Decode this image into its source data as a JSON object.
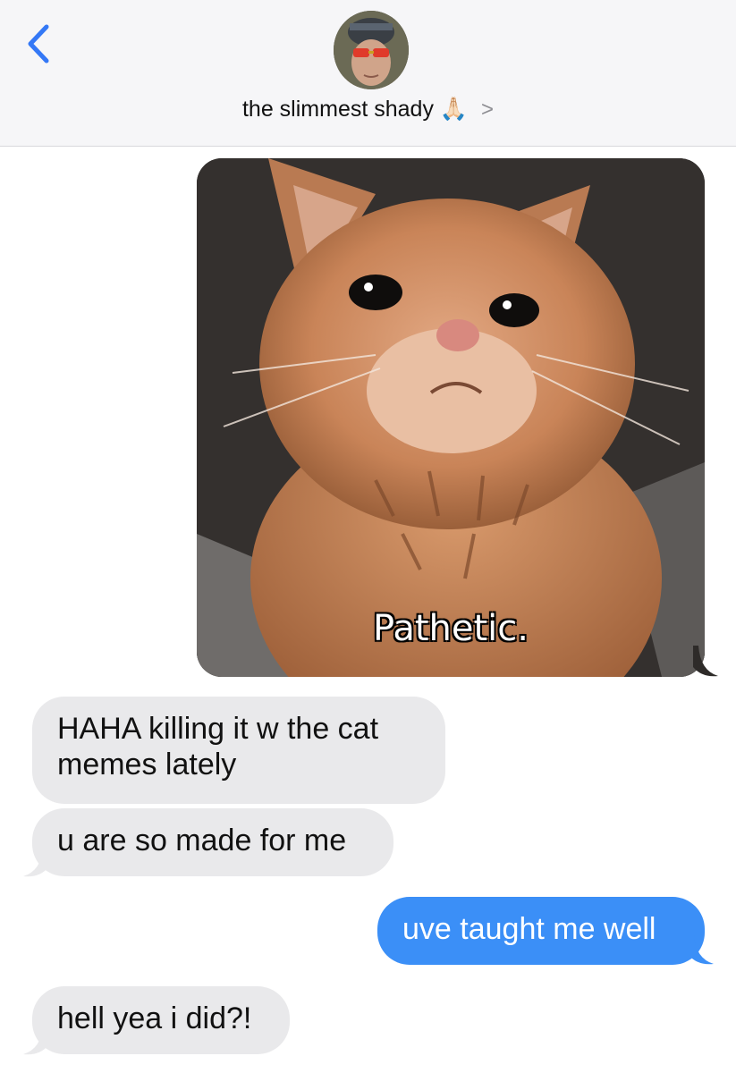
{
  "header": {
    "contact_name": "the slimmest shady",
    "contact_emoji": "🙏🏻",
    "chevron": ">",
    "icons": {
      "back": "chevron-left-icon",
      "details": "chevron-right-icon"
    }
  },
  "messages": [
    {
      "direction": "outgoing",
      "type": "image",
      "image_caption": "Pathetic."
    },
    {
      "direction": "incoming",
      "type": "text",
      "text": "HAHA killing it w the cat memes lately"
    },
    {
      "direction": "incoming",
      "type": "text",
      "text": "u are so made for me"
    },
    {
      "direction": "outgoing",
      "type": "text",
      "text": "uve taught me well"
    },
    {
      "direction": "incoming",
      "type": "text",
      "text": "hell yea i did?!"
    }
  ],
  "colors": {
    "accent": "#3b8ff7",
    "incoming_bubble": "#e9e9eb",
    "header_bg": "#f6f6f8",
    "back_icon": "#3478f6"
  }
}
